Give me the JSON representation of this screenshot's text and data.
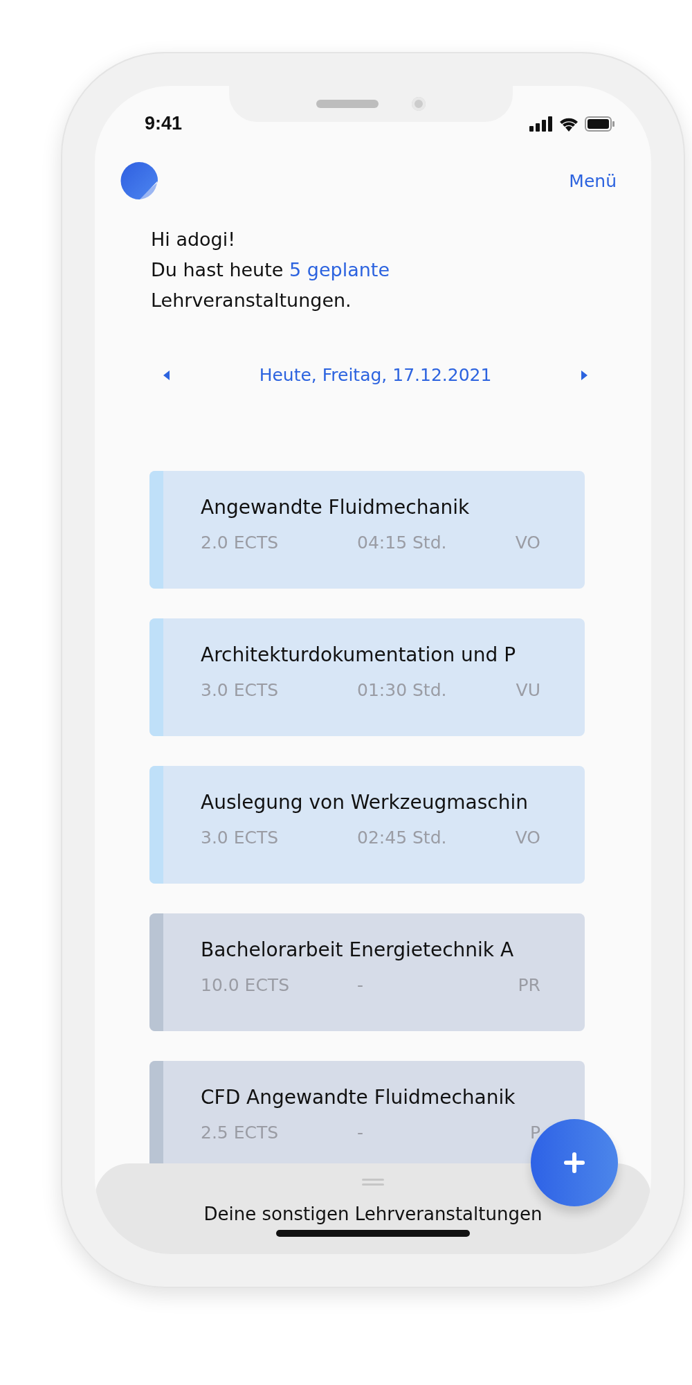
{
  "status_bar": {
    "time": "9:41"
  },
  "header": {
    "menu": "Menü"
  },
  "greeting": {
    "line_1": "Hi adogi!",
    "line_2_start": "Du hast heute",
    "line_2_highlight": "5 geplante",
    "line_3": "Lehrveranstaltungen."
  },
  "date_nav": {
    "label": "Heute, Freitag, 17.12.2021"
  },
  "courses": [
    {
      "title": "Angewandte Fluidmechanik",
      "ects": "2.0 ECTS",
      "hours": "04:15 Std.",
      "type": "VO",
      "color": "#bfe0f9"
    },
    {
      "title": "Architekturdokumentation und P",
      "ects": "3.0 ECTS",
      "hours": "01:30 Std.",
      "type": "VU",
      "color": "#bfe0f9"
    },
    {
      "title": "Auslegung von Werkzeugmaschin",
      "ects": "3.0 ECTS",
      "hours": "02:45 Std.",
      "type": "VO",
      "color": "#bfe0f9"
    },
    {
      "title": "Bachelorarbeit Energietechnik A",
      "ects": "10.0 ECTS",
      "hours": "-",
      "type": "PR",
      "color": "#b9c4d3"
    },
    {
      "title": "CFD Angewandte Fluidmechanik",
      "ects": "2.5 ECTS",
      "hours": "-",
      "type": "P",
      "color": "#b9c4d3"
    }
  ],
  "bottom_sheet": {
    "title": "Deine sonstigen Lehrveranstaltungen"
  }
}
